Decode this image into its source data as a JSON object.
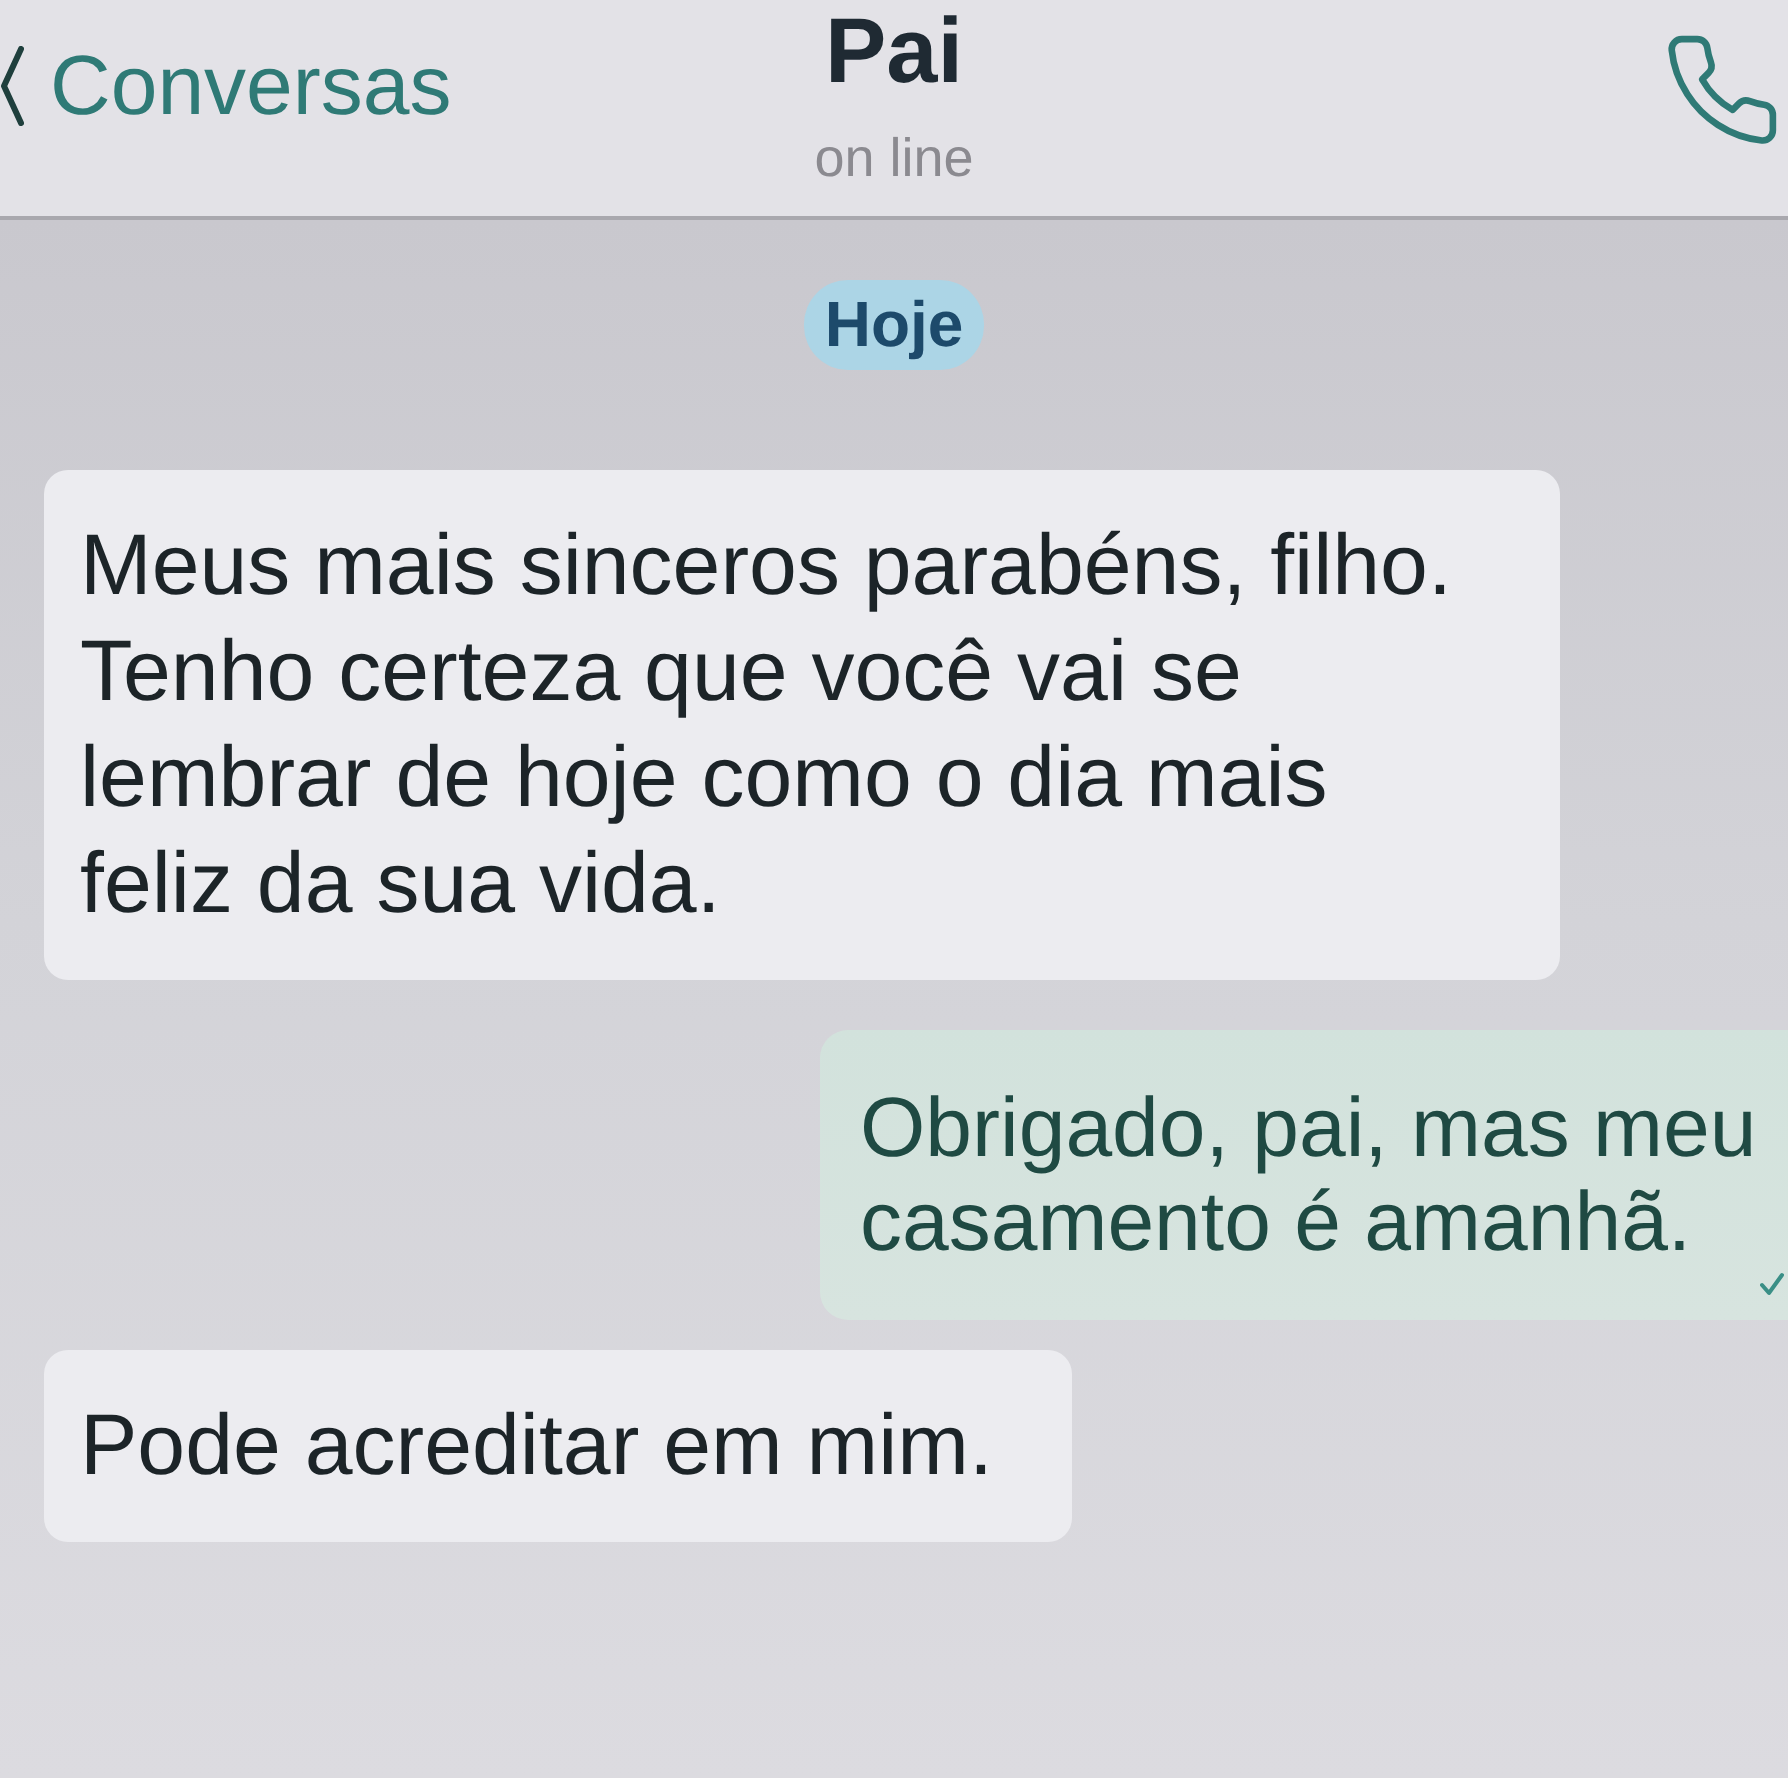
{
  "header": {
    "back_label": "Conversas",
    "contact_name": "Pai",
    "status": "on line"
  },
  "date_label": "Hoje",
  "messages": [
    {
      "kind": "incoming",
      "text": "Meus mais sinceros parabéns, filho. Tenho certeza que você vai se lembrar de hoje como o dia mais feliz da sua vida.",
      "delivered": false
    },
    {
      "kind": "outgoing",
      "text": "Obrigado, pai, mas meu casamento é amanhã.",
      "delivered": true
    },
    {
      "kind": "incoming",
      "text": "Pode acreditar em mim.",
      "delivered": false
    }
  ]
}
